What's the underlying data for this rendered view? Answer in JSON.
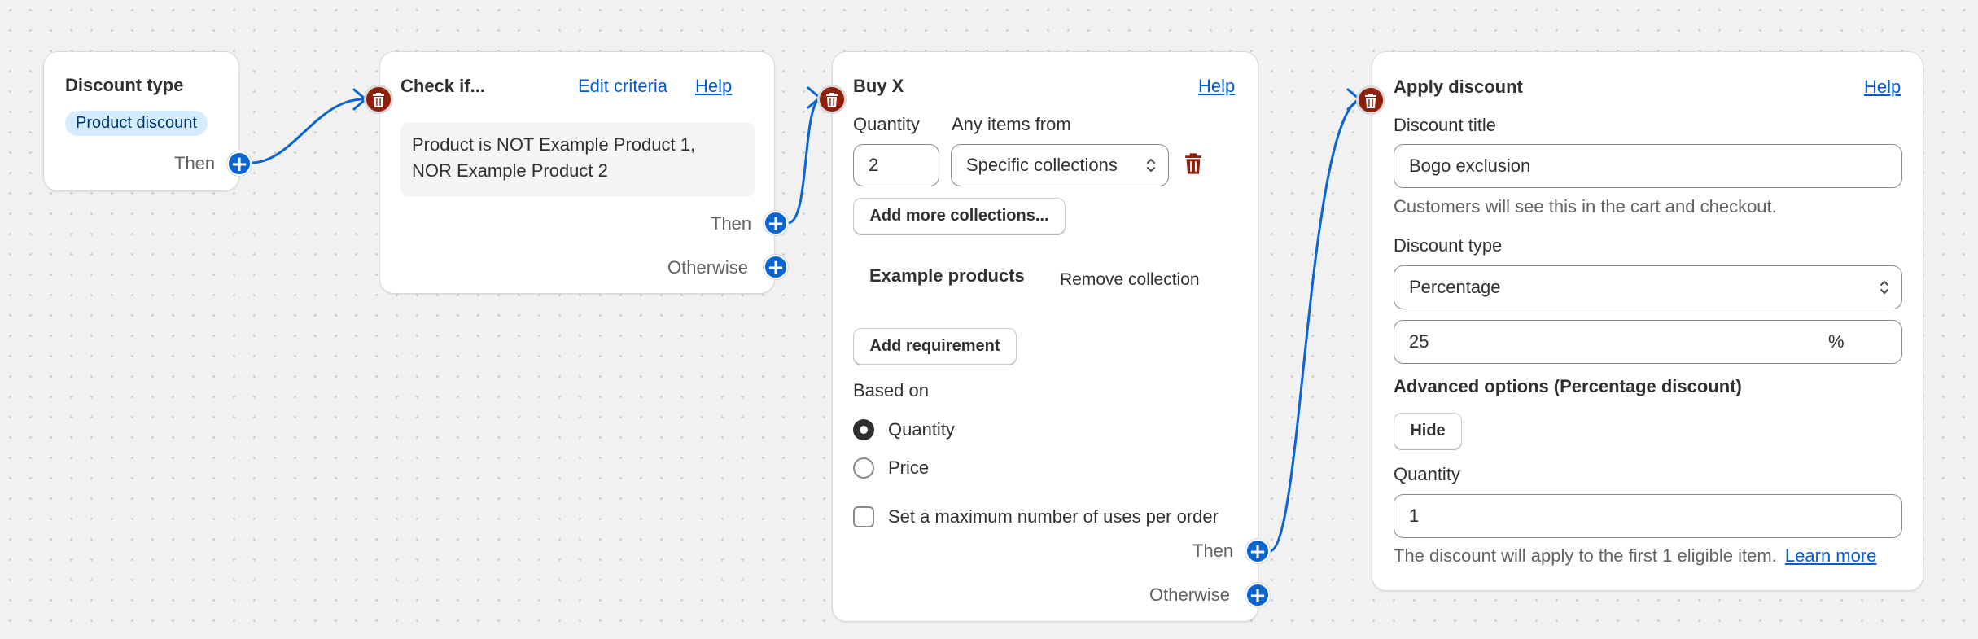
{
  "discount_type_card": {
    "title": "Discount type",
    "badge": "Product discount",
    "then_label": "Then"
  },
  "check_card": {
    "title": "Check if...",
    "edit_criteria": "Edit criteria",
    "help": "Help",
    "condition_line1": "Product is NOT Example Product 1,",
    "condition_line2": "NOR Example Product 2",
    "then_label": "Then",
    "otherwise_label": "Otherwise"
  },
  "buy_card": {
    "title": "Buy X",
    "help": "Help",
    "quantity_label": "Quantity",
    "any_items_label": "Any items from",
    "quantity_value": "2",
    "collections_select": "Specific collections",
    "add_more_collections": "Add more collections...",
    "collection_name": "Example products",
    "remove_collection": "Remove collection",
    "add_requirement": "Add requirement",
    "based_on_label": "Based on",
    "radio_quantity": "Quantity",
    "radio_price": "Price",
    "max_uses_label": "Set a maximum number of uses per order",
    "then_label": "Then",
    "otherwise_label": "Otherwise"
  },
  "apply_card": {
    "title": "Apply discount",
    "help": "Help",
    "discount_title_label": "Discount title",
    "discount_title_value": "Bogo exclusion",
    "discount_title_help": "Customers will see this in the cart and checkout.",
    "discount_type_label": "Discount type",
    "discount_type_value": "Percentage",
    "percent_value": "25",
    "percent_suffix": "%",
    "advanced_label": "Advanced options (Percentage discount)",
    "hide_button": "Hide",
    "quantity_label": "Quantity",
    "quantity_value": "1",
    "apply_help": "The discount will apply to the first 1 eligible item.",
    "learn_more": "Learn more"
  },
  "colors": {
    "accent": "#005bd3",
    "plus_button": "#0a64d2",
    "trash_badge": "#8e1f0b",
    "trash_icon_red": "#8e1f0b",
    "connector": "#0a64d2"
  },
  "icons": {
    "plus": "plus-icon",
    "trash": "trash-icon",
    "chevron": "select-chevron-icon"
  }
}
